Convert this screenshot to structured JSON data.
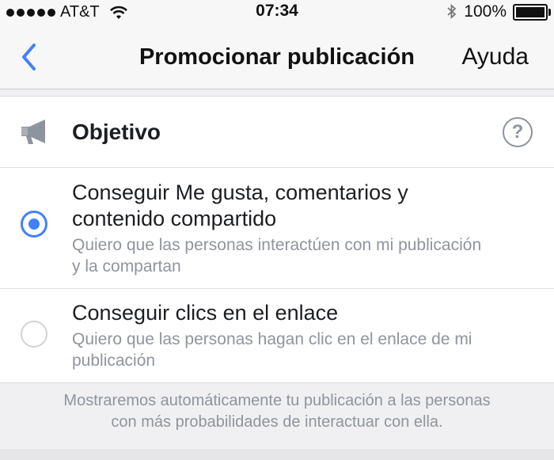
{
  "status_bar": {
    "carrier": "AT&T",
    "time": "07:34",
    "battery_percent": "100%",
    "battery_level": 1.0,
    "signal_bars": 5
  },
  "nav": {
    "title": "Promocionar publicación",
    "help_label": "Ayuda",
    "back_icon": "chevron-left-icon"
  },
  "objective": {
    "title": "Objetivo",
    "icon": "megaphone-icon",
    "help_icon": "question-icon",
    "help_glyph": "?"
  },
  "options": [
    {
      "title_line1": "Conseguir Me gusta, comentarios y",
      "title_line2": "contenido compartido",
      "desc_line1": "Quiero que las personas interactúen con mi publicación",
      "desc_line2": "y la compartan",
      "selected": true
    },
    {
      "title_line1": "Conseguir clics en el enlace",
      "desc_line1": "Quiero que las personas hagan clic en el enlace de mi",
      "desc_line2": "publicación",
      "selected": false
    }
  ],
  "footer": {
    "line1": "Mostraremos automáticamente tu publicación a las personas",
    "line2": "con más probabilidades de interactuar con ella."
  },
  "colors": {
    "accent": "#4080ff",
    "secondary_text": "#90949c"
  }
}
